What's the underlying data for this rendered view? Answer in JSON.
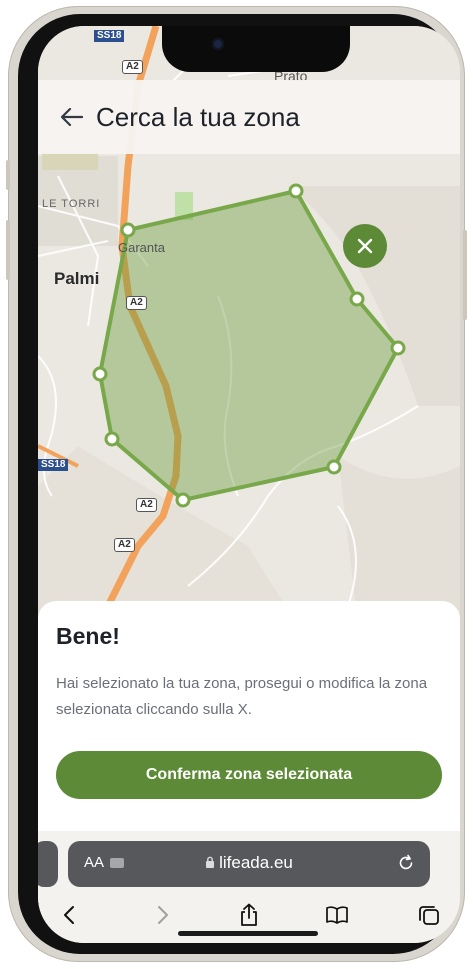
{
  "header": {
    "title": "Cerca la tua zona"
  },
  "map": {
    "place_labels": [
      "Prato",
      "LE TORRI",
      "Garanta",
      "Palmi"
    ],
    "road_shields": [
      "SS18",
      "A2",
      "A2",
      "A2",
      "A2",
      "SS18"
    ],
    "zone_color": "#6a9a3e"
  },
  "sheet": {
    "heading": "Bene!",
    "message": "Hai selezionato la tua zona, prosegui o modifica la zona selezionata cliccando sulla X.",
    "confirm_label": "Conferma zona selezionata"
  },
  "browser": {
    "text_size_label": "AA",
    "url": "lifeada.eu"
  },
  "colors": {
    "accent": "#5d8a37",
    "highway": "#f2a25a"
  },
  "icons": [
    "back-arrow-icon",
    "close-icon",
    "lock-icon",
    "reload-icon",
    "chevron-left-icon",
    "chevron-right-icon",
    "share-icon",
    "bookmarks-icon",
    "tabs-icon"
  ]
}
